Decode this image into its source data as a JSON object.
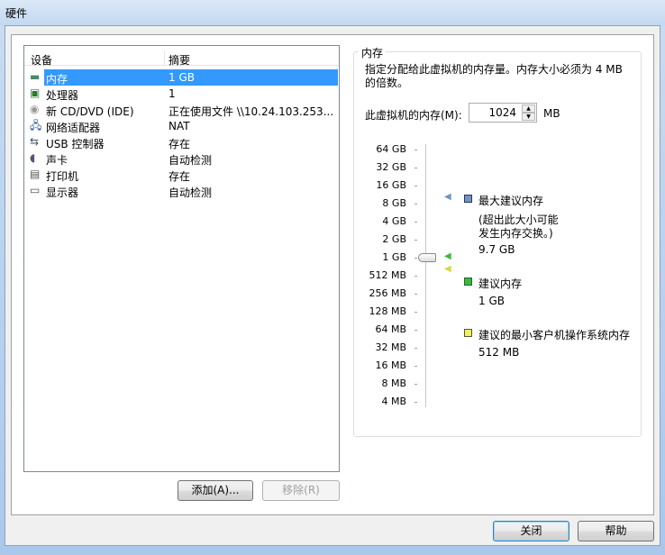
{
  "window": {
    "title": "硬件"
  },
  "device_list": {
    "columns": [
      "设备",
      "摘要"
    ],
    "rows": [
      {
        "name": "内存",
        "summary": "1 GB",
        "icon": "memory-icon",
        "selected": true
      },
      {
        "name": "处理器",
        "summary": "1",
        "icon": "processor-icon"
      },
      {
        "name": "新 CD/DVD (IDE)",
        "summary": "正在使用文件 \\\\10.24.103.253...",
        "icon": "cd-dvd-icon"
      },
      {
        "name": "网络适配器",
        "summary": "NAT",
        "icon": "network-adapter-icon"
      },
      {
        "name": "USB 控制器",
        "summary": "存在",
        "icon": "usb-icon"
      },
      {
        "name": "声卡",
        "summary": "自动检测",
        "icon": "sound-card-icon"
      },
      {
        "name": "打印机",
        "summary": "存在",
        "icon": "printer-icon"
      },
      {
        "name": "显示器",
        "summary": "自动检测",
        "icon": "display-icon"
      }
    ],
    "add_label": "添加(A)...",
    "remove_label": "移除(R)"
  },
  "memory": {
    "group_label": "内存",
    "description": "指定分配给此虚拟机的内存量。内存大小必须为 4 MB 的倍数。",
    "field_label": "此虚拟机的内存(M):",
    "value": "1024",
    "unit": "MB",
    "scale_labels": [
      "64 GB",
      "32 GB",
      "16 GB",
      "8 GB",
      "4 GB",
      "2 GB",
      "1 GB",
      "512 MB",
      "256 MB",
      "128 MB",
      "64 MB",
      "32 MB",
      "16 MB",
      "8 MB",
      "4 MB"
    ],
    "slider_value_mb": 1024,
    "legend": {
      "max_title": "最大建议内存",
      "max_note1": "(超出此大小可能",
      "max_note2": "发生内存交换。)",
      "max_value": "9.7 GB",
      "max_value_mb": 9933,
      "max_color": "#6f94c6",
      "rec_title": "建议内存",
      "rec_value": "1 GB",
      "rec_value_mb": 1024,
      "rec_color": "#3cb83c",
      "min_title": "建议的最小客户机操作系统内存",
      "min_value": "512 MB",
      "min_value_mb": 512,
      "min_color": "#f0f060"
    }
  },
  "footer": {
    "close_label": "关闭",
    "help_label": "帮助"
  }
}
